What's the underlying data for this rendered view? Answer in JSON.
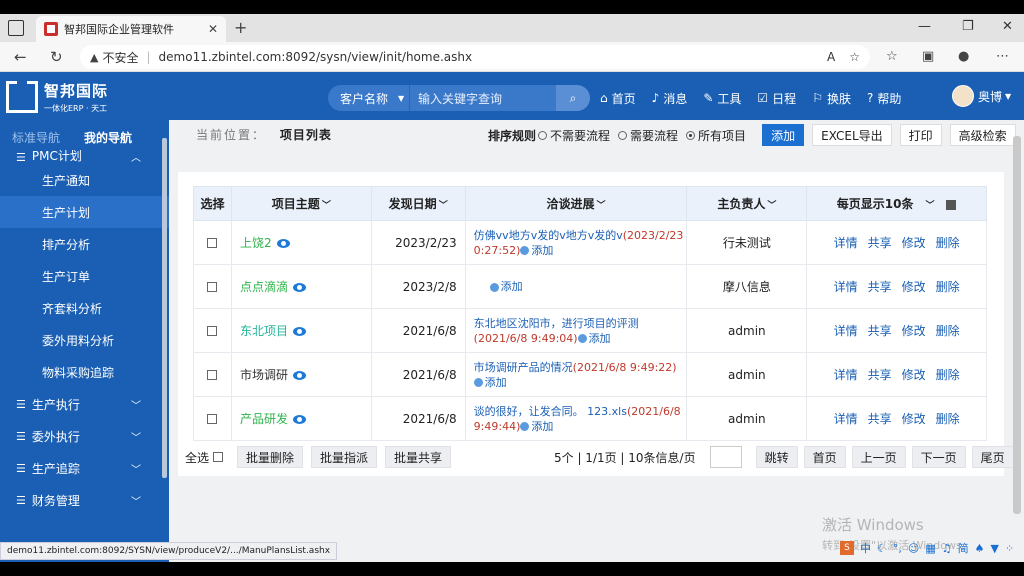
{
  "browser": {
    "tab_title": "智邦国际企业管理软件",
    "not_secure": "不安全",
    "url": "demo11.zbintel.com:8092/sysn/view/init/home.ashx"
  },
  "header": {
    "logo_title": "智邦国际",
    "logo_sub": "一体化ERP · 天工",
    "search_select": "客户名称",
    "search_placeholder": "输入关键字查询",
    "menu": [
      "首页",
      "消息",
      "工具",
      "日程",
      "换肤",
      "帮助"
    ],
    "user": "奥博"
  },
  "sidebar": {
    "tab_standard": "标准导航",
    "tab_mine": "我的导航",
    "top_group": "PMC计划",
    "items": [
      "生产通知",
      "生产计划",
      "排产分析",
      "生产订单",
      "齐套料分析",
      "委外用料分析",
      "物料采购追踪"
    ],
    "active_item": "生产计划",
    "groups": [
      "生产执行",
      "委外执行",
      "生产追踪",
      "财务管理"
    ]
  },
  "toolbar": {
    "crumb_label": "当前位置：",
    "crumb_value": "项目列表",
    "sort_label": "排序规则",
    "radio_options": [
      "不需要流程",
      "需要流程",
      "所有项目"
    ],
    "radio_selected": "所有项目",
    "btn_add": "添加",
    "btn_excel": "EXCEL导出",
    "btn_print": "打印",
    "btn_advanced": "高级检索"
  },
  "table": {
    "headers": {
      "select": "选择",
      "subject": "项目主题",
      "date": "发现日期",
      "progress": "洽谈进展",
      "owner": "主负责人",
      "per_page": "每页显示10条"
    },
    "rows": [
      {
        "name": "上饶2",
        "date": "2023/2/23",
        "progress": "仿佛vv地方v发的v地方v发的v",
        "progress_date": "(2023/2/23 0:27:52)",
        "owner": "行未测试"
      },
      {
        "name": "点点滴滴",
        "date": "2023/2/8",
        "progress": "",
        "progress_date": "",
        "owner": "摩八信息"
      },
      {
        "name": "东北项目",
        "date": "2021/6/8",
        "progress": "东北地区沈阳市，进行项目的评测",
        "progress_date": "(2021/6/8 9:49:04)",
        "owner": "admin"
      },
      {
        "name": "市场调研",
        "date": "2021/6/8",
        "progress": "市场调研产品的情况",
        "progress_date": "(2021/6/8 9:49:22)",
        "owner": "admin"
      },
      {
        "name": "产品研发",
        "date": "2021/6/8",
        "progress": "谈的很好，让发合同。 123.xls",
        "progress_date": "(2021/6/8 9:49:44)",
        "owner": "admin"
      }
    ],
    "add_link": "添加",
    "ops": [
      "详情",
      "共享",
      "修改",
      "删除"
    ]
  },
  "footer": {
    "select_all": "全选",
    "btn_batch_delete": "批量删除",
    "btn_batch_assign": "批量指派",
    "btn_batch_share": "批量共享",
    "page_info": "5个 | 1/1页 | 10条信息/页",
    "btn_jump": "跳转",
    "btn_first": "首页",
    "btn_prev": "上一页",
    "btn_next": "下一页",
    "btn_last": "尾页"
  },
  "status_url": "demo11.zbintel.com:8092/SYSN/view/produceV2/.../ManuPlansList.ashx",
  "watermark": {
    "line1": "激活 Windows",
    "line2": "转到\"设置\"以激活 Windows。"
  },
  "ime": [
    "中",
    "简"
  ]
}
